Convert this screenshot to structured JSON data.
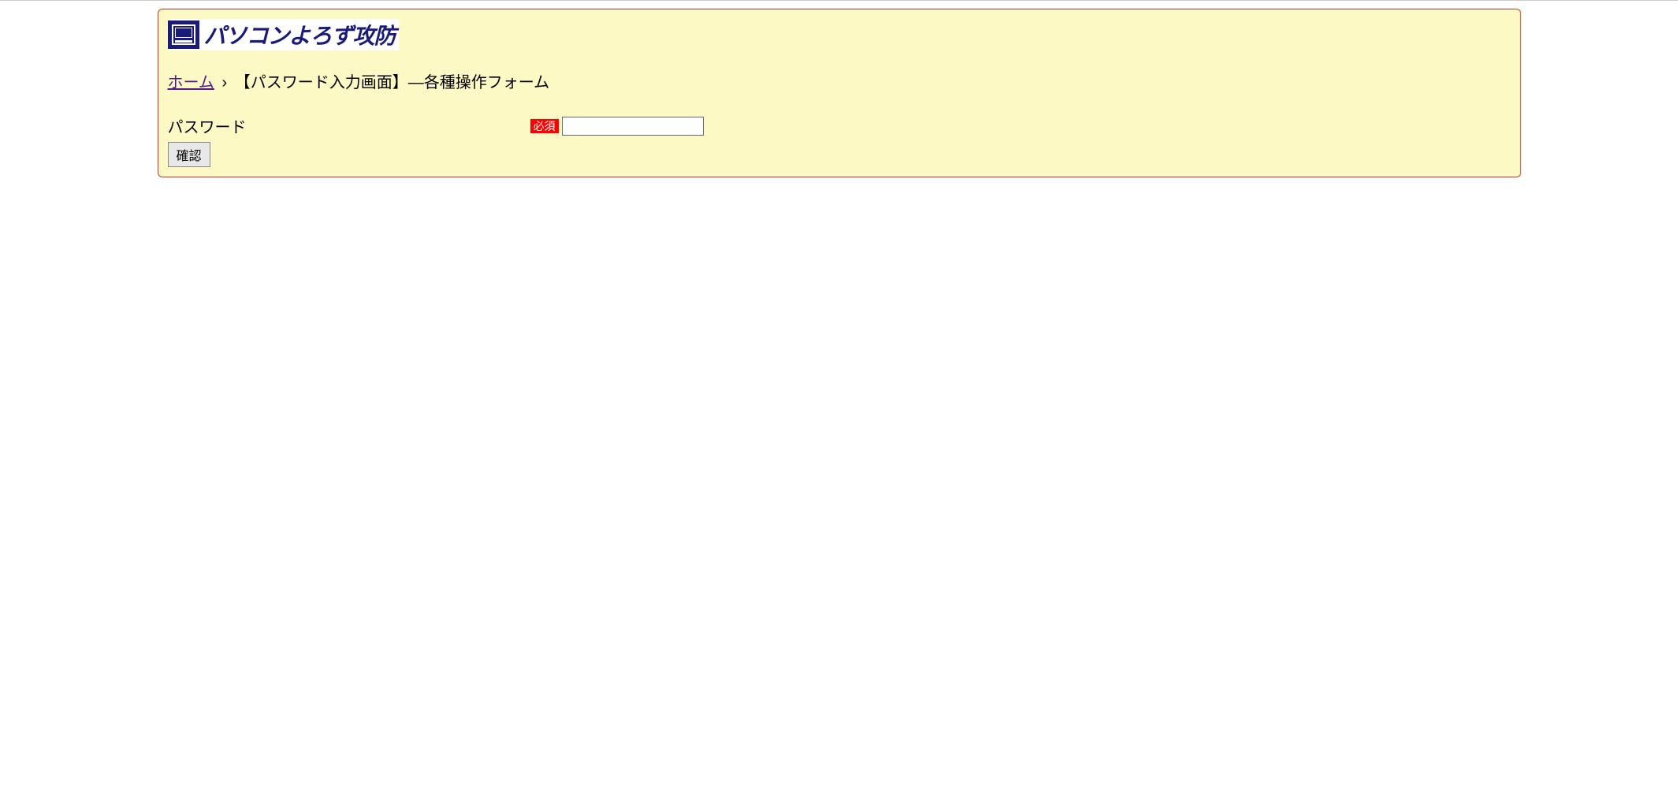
{
  "logo": {
    "text": "パソコンよろず攻防"
  },
  "breadcrumb": {
    "home_label": "ホーム",
    "separator": "›",
    "current": "【パスワード入力画面】―各種操作フォーム"
  },
  "form": {
    "password_label": "パスワード",
    "required_badge": "必須",
    "submit_label": "確認"
  }
}
